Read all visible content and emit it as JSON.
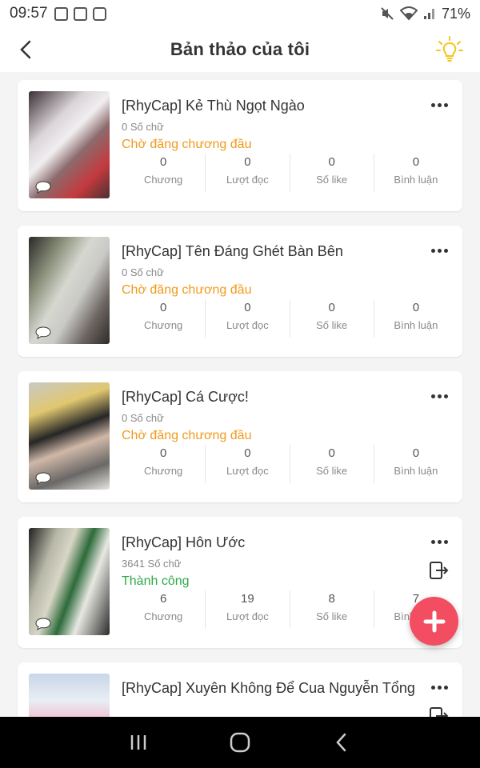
{
  "status_bar": {
    "time": "09:57",
    "battery": "71%"
  },
  "header": {
    "title": "Bản thảo của tôi"
  },
  "stat_labels": {
    "chapters": "Chương",
    "reads": "Lượt đọc",
    "likes": "Số like",
    "comments": "Bình luận"
  },
  "colors": {
    "accent": "#f24d60",
    "pending": "#f09a1c",
    "success": "#2eaa4b",
    "bulb": "#f5c518"
  },
  "stories": [
    {
      "title": "[RhyCap] Kẻ Thù Ngọt Ngào",
      "words": "0 Số chữ",
      "status": "Chờ đăng chương đầu",
      "chapters": "0",
      "reads": "0",
      "likes": "0",
      "comments": "0"
    },
    {
      "title": "[RhyCap] Tên Đáng Ghét Bàn Bên",
      "words": "0 Số chữ",
      "status": "Chờ đăng chương đầu",
      "chapters": "0",
      "reads": "0",
      "likes": "0",
      "comments": "0"
    },
    {
      "title": "[RhyCap] Cá Cược!",
      "words": "0 Số chữ",
      "status": "Chờ đăng chương đầu",
      "chapters": "0",
      "reads": "0",
      "likes": "0",
      "comments": "0"
    },
    {
      "title": "[RhyCap] Hôn Ước",
      "words": "3641 Số chữ",
      "status": "Thành công",
      "chapters": "6",
      "reads": "19",
      "likes": "8",
      "comments": "7"
    },
    {
      "title": "[RhyCap] Xuyên Không Để Cua Nguyễn Tổng"
    }
  ],
  "icons": [
    "back-arrow-icon",
    "lightbulb-icon",
    "more-dots-icon",
    "publish-icon",
    "comment-bubble-icon",
    "plus-icon",
    "recent-apps-icon",
    "home-icon",
    "nav-back-icon"
  ]
}
